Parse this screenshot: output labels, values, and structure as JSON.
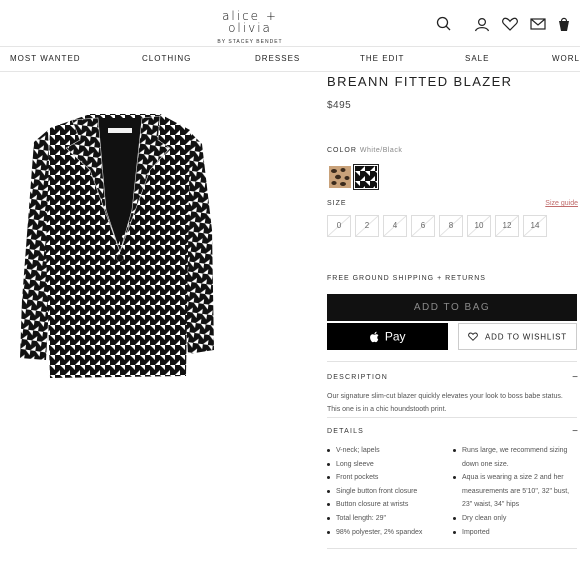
{
  "header": {
    "logo_main": "alice + olivia",
    "logo_sub": "BY STACEY BENDET",
    "icons": [
      "search-icon",
      "account-icon",
      "heart-icon",
      "mail-icon",
      "bag-icon"
    ]
  },
  "nav": {
    "items": [
      "MOST WANTED",
      "CLOTHING",
      "DRESSES",
      "THE EDIT",
      "SALE",
      "WORLD"
    ]
  },
  "product": {
    "title": "BREANN FITTED BLAZER",
    "price": "$495",
    "color_label": "COLOR",
    "color_value": "White/Black",
    "swatches": [
      {
        "name": "leopard",
        "selected": false
      },
      {
        "name": "houndstooth",
        "selected": true
      }
    ],
    "size_label": "SIZE",
    "size_guide": "Size guide",
    "sizes": [
      "0",
      "2",
      "4",
      "6",
      "8",
      "10",
      "12",
      "14"
    ],
    "shipping": "FREE GROUND SHIPPING + RETURNS",
    "add_to_bag": "ADD TO BAG",
    "apple_pay": "Pay",
    "wishlist": "ADD TO WISHLIST"
  },
  "description": {
    "heading": "DESCRIPTION",
    "toggle": "−",
    "text": "Our signature slim-cut blazer quickly elevates your look to boss babe status. This one is in a chic houndstooth print."
  },
  "details": {
    "heading": "DETAILS",
    "toggle": "−",
    "left": [
      "V-neck; lapels",
      "Long sleeve",
      "Front pockets",
      "Single button front closure",
      "Button closure at wrists",
      "Total length: 29\"",
      "98% polyester, 2% spandex"
    ],
    "right": [
      "Runs large, we recommend sizing down one size.",
      "Aqua is wearing a size 2 and her measurements are 5'10\", 32\" bust, 23\" waist, 34\" hips",
      "Dry clean only",
      "Imported"
    ]
  },
  "colors": {
    "sale_pink": "#c06b6b",
    "button_black": "#111111",
    "button_text": "#8a8a8a"
  }
}
